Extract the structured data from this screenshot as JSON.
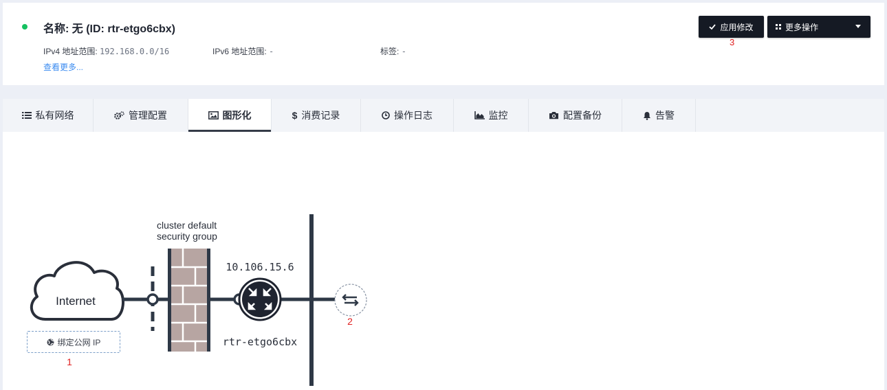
{
  "header": {
    "title": "名称: 无 (ID: rtr-etgo6cbx)",
    "ipv4_label": "IPv4 地址范围:",
    "ipv4_value": "192.168.0.0/16",
    "ipv6_label": "IPv6 地址范围:",
    "ipv6_value": "-",
    "tags_label": "标签:",
    "tags_value": "-",
    "see_more": "查看更多...",
    "apply_label": "应用修改",
    "more_label": "更多操作",
    "marker_apply": "3",
    "status_color": "#15c160"
  },
  "tabs": [
    {
      "label": "私有网络",
      "icon": "list-icon"
    },
    {
      "label": "管理配置",
      "icon": "gears-icon"
    },
    {
      "label": "图形化",
      "icon": "image-icon",
      "active": true
    },
    {
      "label": "消费记录",
      "icon": "dollar-icon"
    },
    {
      "label": "操作日志",
      "icon": "clock-icon"
    },
    {
      "label": "监控",
      "icon": "area-chart-icon"
    },
    {
      "label": "配置备份",
      "icon": "camera-icon"
    },
    {
      "label": "告警",
      "icon": "bell-icon"
    }
  ],
  "diagram": {
    "internet_label": "Internet",
    "bind_ip_label": "绑定公网 IP",
    "marker_bind": "1",
    "sg_line1": "cluster default",
    "sg_line2": "security group",
    "router_ip": "10.106.15.6",
    "router_id": "rtr-etgo6cbx",
    "marker_connect": "2"
  }
}
